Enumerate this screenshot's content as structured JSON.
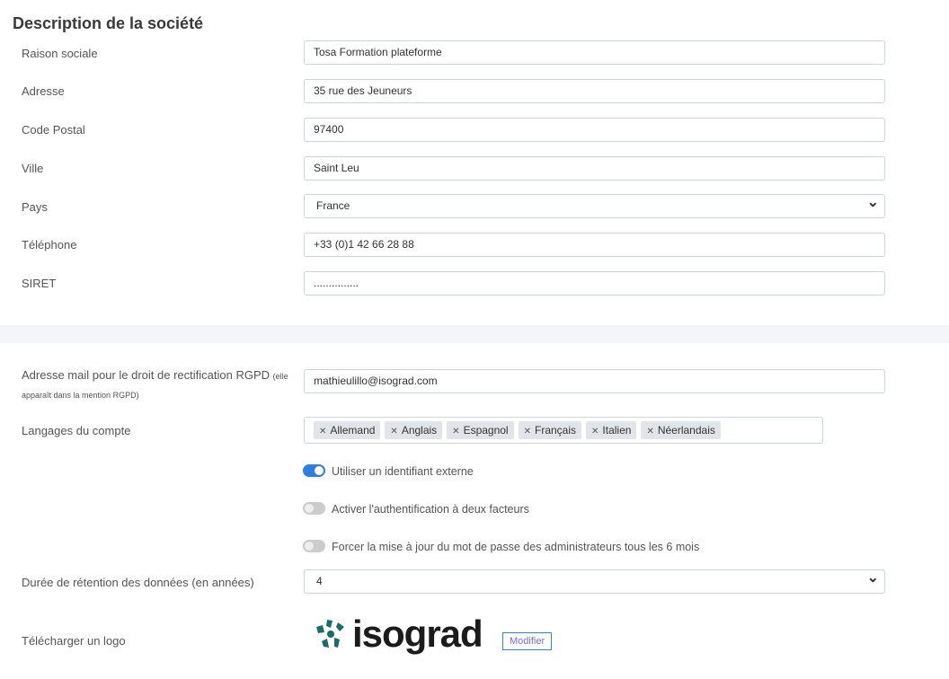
{
  "section_title": "Description de la société",
  "fields": [
    {
      "label": "Raison sociale",
      "value": "Tosa Formation plateforme"
    },
    {
      "label": "Adresse",
      "value": "35 rue des Jeuneurs"
    },
    {
      "label": "Code Postal",
      "value": "97400"
    },
    {
      "label": "Ville",
      "value": "Saint Leu"
    },
    {
      "label": "Pays",
      "value": "France"
    },
    {
      "label": "Téléphone",
      "value": "+33 (0)1 42 66 28 88"
    },
    {
      "label": "SIRET",
      "value": "..............."
    }
  ],
  "email": {
    "label": "Adresse mail pour le droit de rectification RGPD",
    "note": "(elle apparaît dans la mention RGPD)",
    "value": "mathieulillo@isograd.com"
  },
  "languages": {
    "label": "Langages du compte",
    "tags": [
      "Allemand",
      "Anglais",
      "Espagnol",
      "Français",
      "Italien",
      "Néerlandais"
    ]
  },
  "toggles": [
    {
      "label": "Utiliser un identifiant externe",
      "on": true
    },
    {
      "label": "Activer l'authentification à deux facteurs",
      "on": false
    },
    {
      "label": "Forcer la mise à jour du mot de passe des administrateurs tous les 6 mois",
      "on": false
    }
  ],
  "retention": {
    "label": "Durée de rétention des données (en années)",
    "value": "4"
  },
  "logo": {
    "label": "Télécharger un logo",
    "logo_text": "isograd",
    "button": "Modifier"
  },
  "colors": {
    "accent": "#2f7de1",
    "logo": "#1c6b68"
  }
}
